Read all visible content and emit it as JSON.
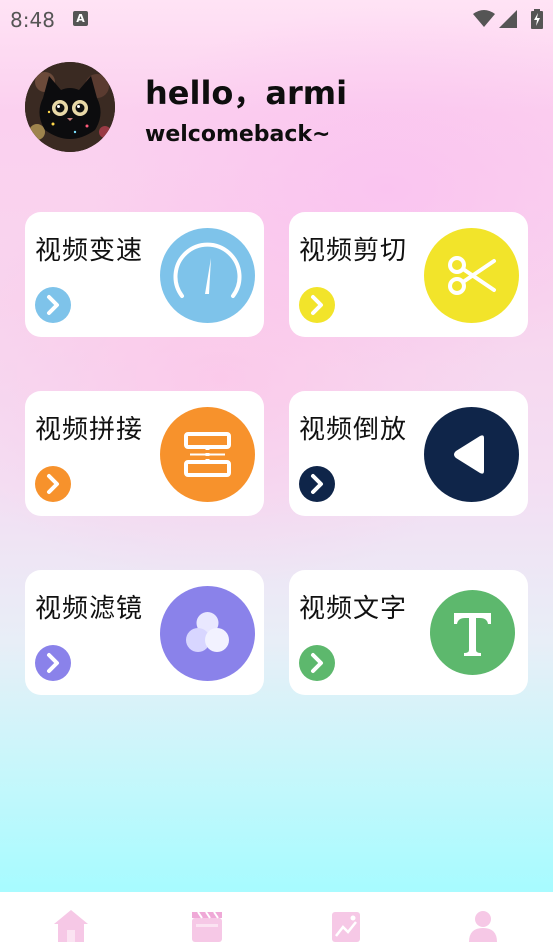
{
  "status_bar": {
    "time": "8:48",
    "notification_icon": "A"
  },
  "header": {
    "greeting": "hello，armi",
    "subtitle": "welcomeback~"
  },
  "tools": [
    {
      "label": "视频变速",
      "icon": "speedometer-icon",
      "color": "#7ec3ea"
    },
    {
      "label": "视频剪切",
      "icon": "scissors-icon",
      "color": "#f2e42a"
    },
    {
      "label": "视频拼接",
      "icon": "merge-icon",
      "color": "#f7922c"
    },
    {
      "label": "视频倒放",
      "icon": "reverse-play-icon",
      "color": "#0f2549"
    },
    {
      "label": "视频滤镜",
      "icon": "filter-circles-icon",
      "color": "#8a82ea"
    },
    {
      "label": "视频文字",
      "icon": "text-t-icon",
      "color": "#5db86d"
    }
  ],
  "nav": {
    "items": [
      "home-icon",
      "video-clapper-icon",
      "image-icon",
      "profile-icon"
    ],
    "color": "#f6c8e6"
  }
}
